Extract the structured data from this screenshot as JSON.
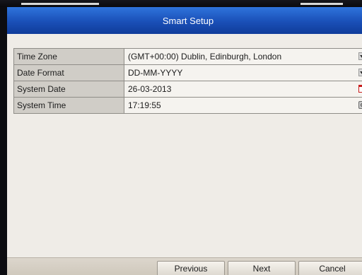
{
  "dialog": {
    "title": "Smart Setup"
  },
  "settings": [
    {
      "label": "Time Zone",
      "value": "(GMT+00:00) Dublin, Edinburgh, London",
      "control_icon": "dropdown-icon"
    },
    {
      "label": "Date Format",
      "value": "DD-MM-YYYY",
      "control_icon": "dropdown-icon"
    },
    {
      "label": "System Date",
      "value": "26-03-2013",
      "control_icon": "calendar-icon"
    },
    {
      "label": "System Time",
      "value": "17:19:55",
      "control_icon": "clock-icon"
    }
  ],
  "buttons": {
    "previous": "Previous",
    "next": "Next",
    "cancel": "Cancel"
  },
  "colors": {
    "titlebar": "#1a4fb7",
    "panel_background": "#efece7",
    "label_cell": "#d0cdc7"
  }
}
